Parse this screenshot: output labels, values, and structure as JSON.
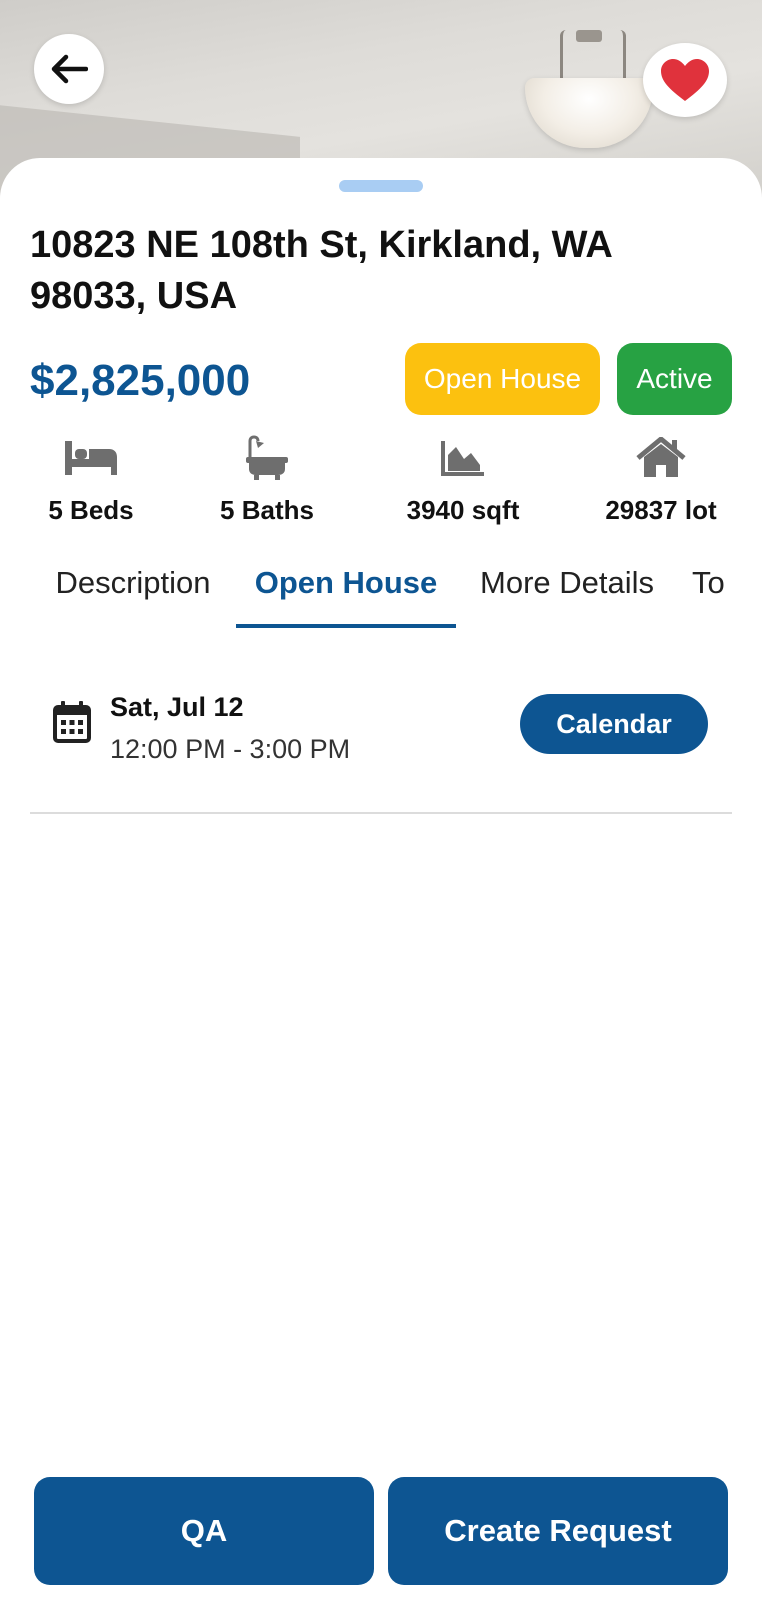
{
  "listing": {
    "address": "10823 NE 108th St, Kirkland, WA 98033, USA",
    "price": "$2,825,000",
    "badges": {
      "open_house": "Open House",
      "status": "Active"
    },
    "stats": [
      {
        "icon": "bed-icon",
        "label": "5 Beds"
      },
      {
        "icon": "bathtub-icon",
        "label": "5 Baths"
      },
      {
        "icon": "area-chart-icon",
        "label": "3940 sqft"
      },
      {
        "icon": "home-icon",
        "label": "29837 lot"
      }
    ]
  },
  "tabs": [
    "Description",
    "Open House",
    "More Details",
    "To"
  ],
  "open_house": {
    "events": [
      {
        "date": "Sat, Jul 12",
        "time": "12:00 PM - 3:00 PM",
        "button": "Calendar"
      }
    ]
  },
  "footer": {
    "qa": "QA",
    "create_request": "Create Request"
  },
  "colors": {
    "primary": "#0d5592",
    "open_house_badge": "#fcc10f",
    "active_badge": "#27a243",
    "heart": "#e0323c",
    "handle": "#a9cdf3"
  }
}
